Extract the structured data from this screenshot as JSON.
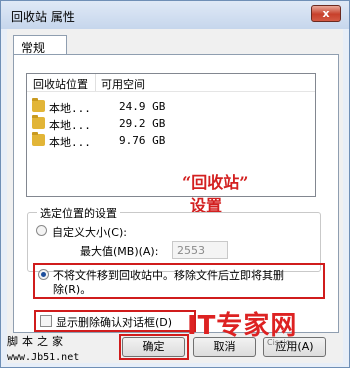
{
  "window": {
    "title": "回收站 属性",
    "close_glyph": "x"
  },
  "tabs": [
    {
      "label": "常规"
    }
  ],
  "list": {
    "columns": [
      "回收站位置",
      "可用空间"
    ],
    "rows": [
      {
        "location": "本地...",
        "space": "24.9 GB"
      },
      {
        "location": "本地...",
        "space": "29.2 GB"
      },
      {
        "location": "本地...",
        "space": "9.76 GB"
      }
    ]
  },
  "annotation": {
    "line1": "“回收站”",
    "line2": "设置",
    "color": "#d32020"
  },
  "settings": {
    "group_title": "选定位置的设置",
    "custom_size_label": "自定义大小(C):",
    "max_label": "最大值(MB)(A):",
    "max_value": "2553",
    "no_move_line1": "不将文件移到回收站中。移除文件后立即将其删",
    "no_move_line2": "除(R)。",
    "confirm_label": "显示删除确认对话框(D)"
  },
  "buttons": {
    "ok": "确定",
    "cancel": "取消",
    "apply": "应用(A)"
  },
  "watermark": {
    "left_text": "脚本之家",
    "url": "www.Jb51.net",
    "logo_text": "IT专家网",
    "logo_sub": "Ciscio..."
  }
}
